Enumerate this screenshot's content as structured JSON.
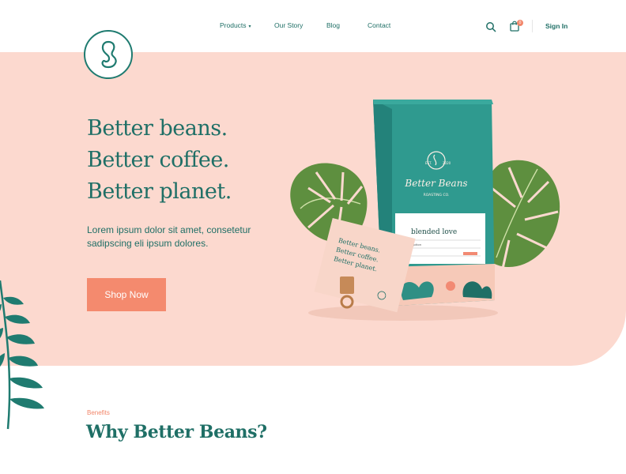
{
  "header": {
    "nav": [
      {
        "label": "Products",
        "has_dropdown": true
      },
      {
        "label": "Our Story"
      },
      {
        "label": "Blog"
      },
      {
        "label": "Contact"
      }
    ],
    "cart_count": "0",
    "signin_label": "Sign In",
    "icons": [
      "logo-bean-icon",
      "search-icon",
      "bag-icon",
      "chevron-down-icon"
    ]
  },
  "hero": {
    "headline": [
      "Better beans.",
      "Better coffee.",
      "Better planet."
    ],
    "copy": "Lorem ipsum dolor sit amet, consetetur sadipscing eli ipsum dolores.",
    "cta_label": "Shop Now"
  },
  "product": {
    "bag_est": "EST.",
    "bag_year": "2020",
    "bag_brand": "Better Beans",
    "bag_sub": "ROASTING CO.",
    "label_title": "blended love",
    "label_row": "description",
    "card_lines": [
      "Better beans.",
      "Better coffee.",
      "Better planet."
    ]
  },
  "benefits": {
    "eyebrow": "Benefits",
    "title": "Why Better Beans?"
  },
  "colors": {
    "brand_teal": "#1f6f66",
    "hero_pink": "#fcd9cf",
    "accent_coral": "#f48a6e"
  }
}
